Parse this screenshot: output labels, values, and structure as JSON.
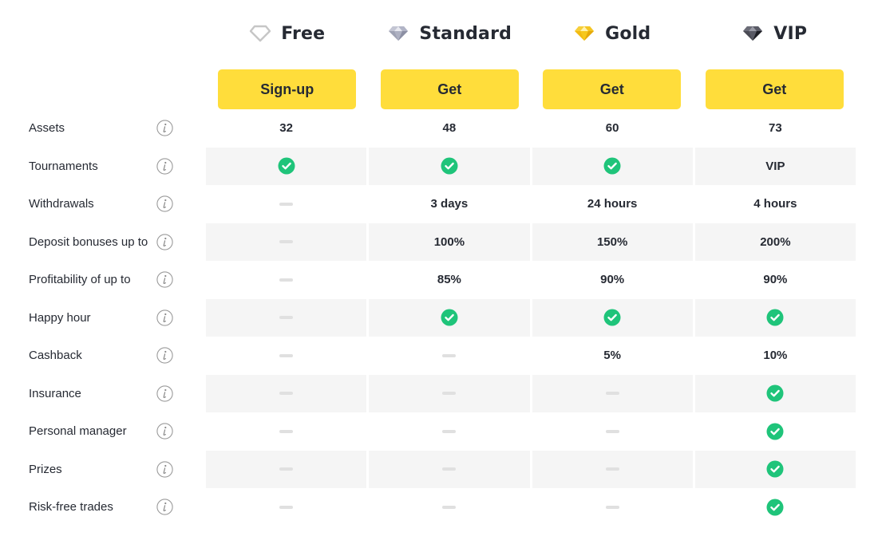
{
  "colors": {
    "accent_button": "#ffdd3b",
    "check_green": "#1fc47a",
    "row_shade": "#f5f5f5",
    "dash": "#e0e0e0",
    "text": "#262a33"
  },
  "plans": [
    {
      "name": "Free",
      "icon": "diamond-outline-icon",
      "cta": "Sign-up"
    },
    {
      "name": "Standard",
      "icon": "silver-diamond-icon",
      "cta": "Get"
    },
    {
      "name": "Gold",
      "icon": "gold-diamond-icon",
      "cta": "Get"
    },
    {
      "name": "VIP",
      "icon": "black-diamond-icon",
      "cta": "Get"
    }
  ],
  "features": [
    {
      "label": "Assets",
      "values": [
        "32",
        "48",
        "60",
        "73"
      ]
    },
    {
      "label": "Tournaments",
      "values": [
        "check",
        "check",
        "check",
        "VIP"
      ]
    },
    {
      "label": "Withdrawals",
      "values": [
        "dash",
        "3 days",
        "24 hours",
        "4 hours"
      ]
    },
    {
      "label": "Deposit bonuses up to",
      "values": [
        "dash",
        "100%",
        "150%",
        "200%"
      ]
    },
    {
      "label": "Profitability of up to",
      "values": [
        "dash",
        "85%",
        "90%",
        "90%"
      ]
    },
    {
      "label": "Happy hour",
      "values": [
        "dash",
        "check",
        "check",
        "check"
      ]
    },
    {
      "label": "Cashback",
      "values": [
        "dash",
        "dash",
        "5%",
        "10%"
      ]
    },
    {
      "label": "Insurance",
      "values": [
        "dash",
        "dash",
        "dash",
        "check"
      ]
    },
    {
      "label": "Personal manager",
      "values": [
        "dash",
        "dash",
        "dash",
        "check"
      ]
    },
    {
      "label": "Prizes",
      "values": [
        "dash",
        "dash",
        "dash",
        "check"
      ]
    },
    {
      "label": "Risk-free trades",
      "values": [
        "dash",
        "dash",
        "dash",
        "check"
      ]
    }
  ]
}
